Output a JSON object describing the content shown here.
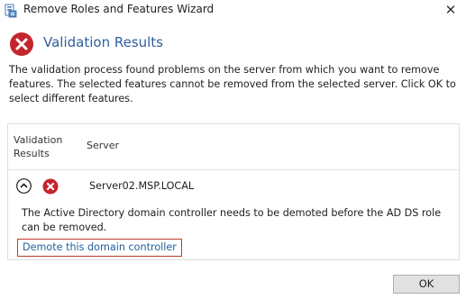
{
  "window": {
    "title": "Remove Roles and Features Wizard",
    "close_glyph": "✕",
    "app_icon": "server-manager-icon"
  },
  "header": {
    "icon": "error-icon",
    "title": "Validation Results"
  },
  "description": "The validation process found problems on the server from which you want to remove features. The selected features cannot be removed from the selected server.  Click OK to select different features.",
  "results_table": {
    "columns": [
      "Validation Results",
      "Server"
    ],
    "rows": [
      {
        "server": "Server02.MSP.LOCAL",
        "status_icon": "error-icon",
        "expanded": true,
        "message": "The Active Directory domain controller needs to be demoted before the AD DS role can be removed.",
        "action_link": "Demote this domain controller"
      }
    ]
  },
  "footer": {
    "ok_label": "OK"
  },
  "colors": {
    "heading": "#2f5f9a",
    "link": "#1f5f9a",
    "error": "#c4262e",
    "highlight_border": "#c0392b"
  }
}
